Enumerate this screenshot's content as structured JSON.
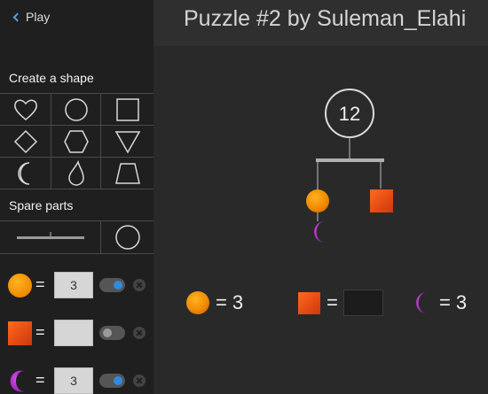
{
  "nav": {
    "back_label": "Play"
  },
  "header": {
    "title": "Puzzle #2 by Suleman_Elahi"
  },
  "sidebar": {
    "create_shape_title": "Create a shape",
    "shapes": [
      "heart",
      "circle",
      "square",
      "diamond",
      "hexagon",
      "triangle-down",
      "crescent",
      "drop",
      "trapezoid"
    ],
    "spare_parts_title": "Spare parts",
    "spare_parts": [
      "bar",
      "circle"
    ],
    "variables": [
      {
        "shape": "orange-circle",
        "value": "3",
        "toggle": "on"
      },
      {
        "shape": "red-square",
        "value": "",
        "toggle": "off"
      },
      {
        "shape": "purple-crescent",
        "value": "3",
        "toggle": "on"
      }
    ]
  },
  "mobile": {
    "total": "12",
    "hanging": [
      "orange-circle",
      "purple-crescent",
      "red-square"
    ]
  },
  "equations": [
    {
      "shape": "orange-circle",
      "sign": "=",
      "value": "3"
    },
    {
      "shape": "red-square",
      "sign": "=",
      "value": ""
    },
    {
      "shape": "purple-crescent",
      "sign": "=",
      "value": "3"
    }
  ],
  "colors": {
    "accent": "#2f8be0",
    "orange": "#f39200",
    "red": "#e24a12",
    "purple": "#b02ec9",
    "outline": "#d8d8d8"
  }
}
